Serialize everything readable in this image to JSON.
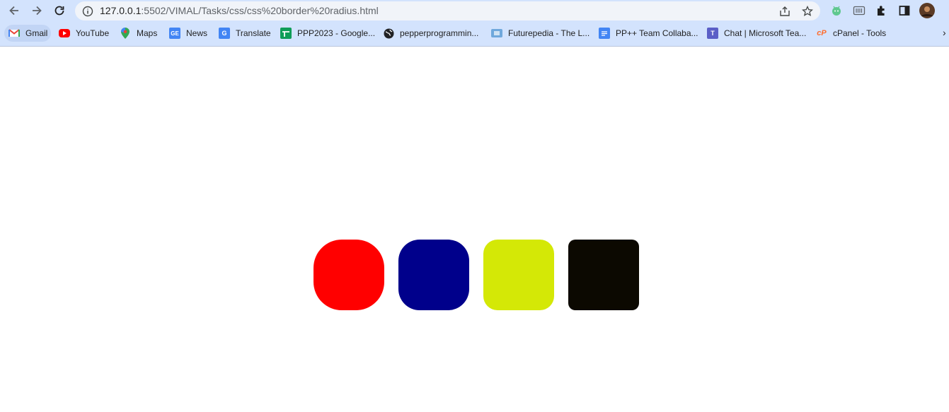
{
  "browser": {
    "url_host": "127.0.0.1",
    "url_rest": ":5502/VIMAL/Tasks/css/css%20border%20radius.html"
  },
  "bookmarks": [
    {
      "label": "Gmail",
      "icon": "gmail-icon"
    },
    {
      "label": "YouTube",
      "icon": "youtube-icon"
    },
    {
      "label": "Maps",
      "icon": "maps-icon"
    },
    {
      "label": "News",
      "icon": "news-icon"
    },
    {
      "label": "Translate",
      "icon": "translate-icon"
    },
    {
      "label": "PPP2023 - Google...",
      "icon": "sheets-icon"
    },
    {
      "label": "pepperprogrammin...",
      "icon": "globe-icon"
    },
    {
      "label": "Futurepedia - The L...",
      "icon": "futurepedia-icon"
    },
    {
      "label": "PP++ Team Collaba...",
      "icon": "docs-icon"
    },
    {
      "label": "Chat | Microsoft Tea...",
      "icon": "teams-icon"
    },
    {
      "label": "cPanel - Tools",
      "icon": "cpanel-icon"
    }
  ],
  "boxes": [
    {
      "color": "#ff0000",
      "radius": "40%"
    },
    {
      "color": "#00008b",
      "radius": "30%"
    },
    {
      "color": "#d4e806",
      "radius": "20%"
    },
    {
      "color": "#0c0901",
      "radius": "10%"
    }
  ]
}
